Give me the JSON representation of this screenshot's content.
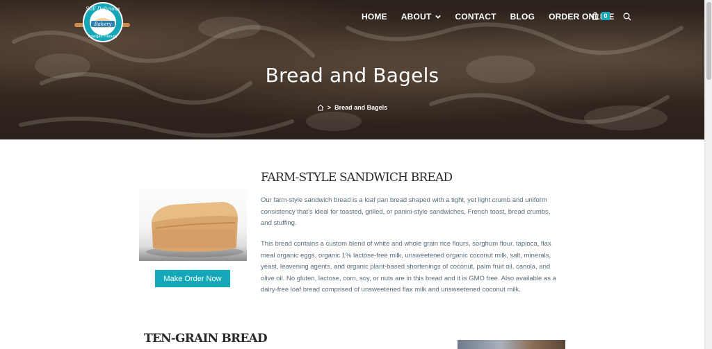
{
  "header": {
    "logo_text": [
      "Still Delicious",
      "Bakery",
      "Allergen Friendly"
    ],
    "nav": [
      {
        "label": "HOME"
      },
      {
        "label": "ABOUT",
        "has_dropdown": true
      },
      {
        "label": "CONTACT"
      },
      {
        "label": "BLOG"
      },
      {
        "label": "ORDER ONLINE"
      }
    ],
    "cart_count": "0",
    "icons": {
      "cart": "shopping-bag-icon",
      "search": "search-icon",
      "home": "home-icon",
      "dropdown": "chevron-down-icon"
    }
  },
  "hero": {
    "title": "Bread and Bagels",
    "breadcrumb": {
      "separator": ">",
      "current": "Bread and Bagels"
    }
  },
  "products": [
    {
      "title": "FARM-STYLE SANDWICH BREAD",
      "paragraphs": [
        "Our farm-style sandwich bread is a loaf pan bread shaped with a tight, yet light crumb and uniform consistency that’s ideal for toasted, grilled, or panini-style sandwiches, French toast, bread crumbs, and stuffing.",
        "This bread contains a custom blend of white and whole grain rice flours, sorghum flour, tapioca, flax meal organic eggs, organic 1% lactose-free milk, unsweetened organic coconut milk, salt, minerals, yeast, leavening agents, and organic plant-based shortenings of coconut, palm fruit oil, canola, and olive oil. No gluten, lactose, corn, soy, or nuts are in this bread and it is GMO free. Also available as a dairy-free loaf bread comprised of unsweetened flax milk and unsweetened coconut milk."
      ],
      "button_label": "Make Order Now"
    },
    {
      "title": "TEN-GRAIN BREAD"
    }
  ],
  "colors": {
    "accent": "#13a7b7",
    "heading": "#2b2b2b",
    "body_text": "#5a6b7a"
  }
}
